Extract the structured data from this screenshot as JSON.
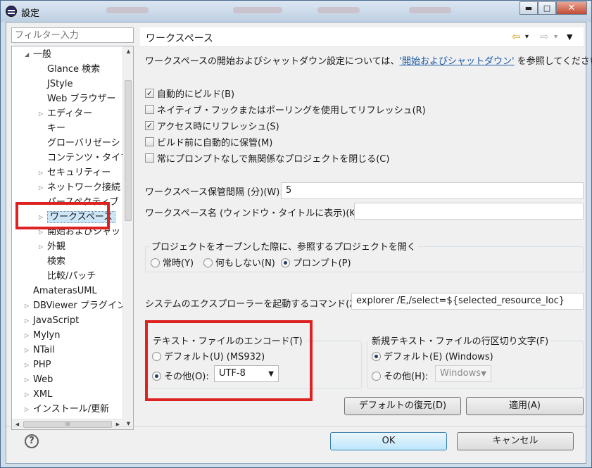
{
  "window": {
    "title": "設定",
    "caption": {
      "minimize": "▬",
      "maximize": "□",
      "close": "✕"
    }
  },
  "filter": {
    "placeholder": "フィルター入力"
  },
  "tree": {
    "items": [
      {
        "label": "一般",
        "twisty": "◢"
      },
      {
        "label": "Glance 検索",
        "twisty": ""
      },
      {
        "label": "JStyle",
        "twisty": ""
      },
      {
        "label": "Web ブラウザー",
        "twisty": ""
      },
      {
        "label": "エディター",
        "twisty": "▷"
      },
      {
        "label": "キー",
        "twisty": ""
      },
      {
        "label": "グローバリゼーシ",
        "twisty": ""
      },
      {
        "label": "コンテンツ・タイプ",
        "twisty": ""
      },
      {
        "label": "セキュリティー",
        "twisty": "▷"
      },
      {
        "label": "ネットワーク接続",
        "twisty": "▷"
      },
      {
        "label": "パースペクティブ",
        "twisty": ""
      },
      {
        "label": "ワークスペース",
        "twisty": "▷"
      },
      {
        "label": "開始およびシャット",
        "twisty": "▷"
      },
      {
        "label": "外観",
        "twisty": "▷"
      },
      {
        "label": "検索",
        "twisty": ""
      },
      {
        "label": "比較/パッチ",
        "twisty": ""
      },
      {
        "label": "AmaterasUML",
        "twisty": ""
      },
      {
        "label": "DBViewer プラグイン",
        "twisty": "▷"
      },
      {
        "label": "JavaScript",
        "twisty": "▷"
      },
      {
        "label": "Mylyn",
        "twisty": "▷"
      },
      {
        "label": "NTail",
        "twisty": "▷"
      },
      {
        "label": "PHP",
        "twisty": "▷"
      },
      {
        "label": "Web",
        "twisty": "▷"
      },
      {
        "label": "XML",
        "twisty": "▷"
      },
      {
        "label": "インストール/更新",
        "twisty": "▷"
      }
    ],
    "hscroll_thumb": "III"
  },
  "page": {
    "title": "ワークスペース",
    "nav": {
      "back": "⇦",
      "forward": "⇨",
      "dropdown": "▾",
      "menu": "▼"
    },
    "description_prefix": "ワークスペースの開始およびシャットダウン設定については、",
    "description_link": "'開始およびシャットダウン'",
    "description_suffix": " を参照してください。",
    "checkboxes": [
      {
        "label": "自動的にビルド(B)",
        "checked": true
      },
      {
        "label": "ネイティブ・フックまたはポーリングを使用してリフレッシュ(R)",
        "checked": false
      },
      {
        "label": "アクセス時にリフレッシュ(S)",
        "checked": true
      },
      {
        "label": "ビルド前に自動的に保管(M)",
        "checked": false
      },
      {
        "label": "常にプロンプトなしで無関係なプロジェクトを閉じる(C)",
        "checked": false
      }
    ],
    "save_interval_label": "ワークスペース保管間隔 (分)(W):",
    "save_interval_value": "5",
    "workspace_name_label": "ワークスペース名 (ウィンドウ・タイトルに表示)(K):",
    "workspace_name_value": "",
    "open_project_group": {
      "title": "プロジェクトをオープンした際に、参照するプロジェクトを開く",
      "options": [
        {
          "label": "常時(Y)",
          "selected": false
        },
        {
          "label": "何もしない(N)",
          "selected": false
        },
        {
          "label": "プロンプト(P)",
          "selected": true
        }
      ]
    },
    "explorer_command_label": "システムのエクスプローラーを起動するコマンド(X):",
    "explorer_command_value": "explorer /E,/select=${selected_resource_loc}",
    "encoding_group": {
      "title": "テキスト・ファイルのエンコード(T)",
      "default_label": "デフォルト(U) (MS932)",
      "other_label": "その他(O):",
      "other_value": "UTF-8",
      "selected": "other"
    },
    "line_delimiter_group": {
      "title": "新規テキスト・ファイルの行区切り文字(F)",
      "default_label": "デフォルト(E) (Windows)",
      "other_label": "その他(H):",
      "other_value": "Windows",
      "selected": "default"
    },
    "restore_defaults_button": "デフォルトの復元(D)",
    "apply_button": "適用(A)"
  },
  "footer": {
    "help_icon": "?",
    "ok_button": "OK",
    "cancel_button": "キャンセル"
  },
  "colors": {
    "highlight": "#dd2222",
    "link": "#1c5aa6",
    "selection": "#cde6f7"
  }
}
